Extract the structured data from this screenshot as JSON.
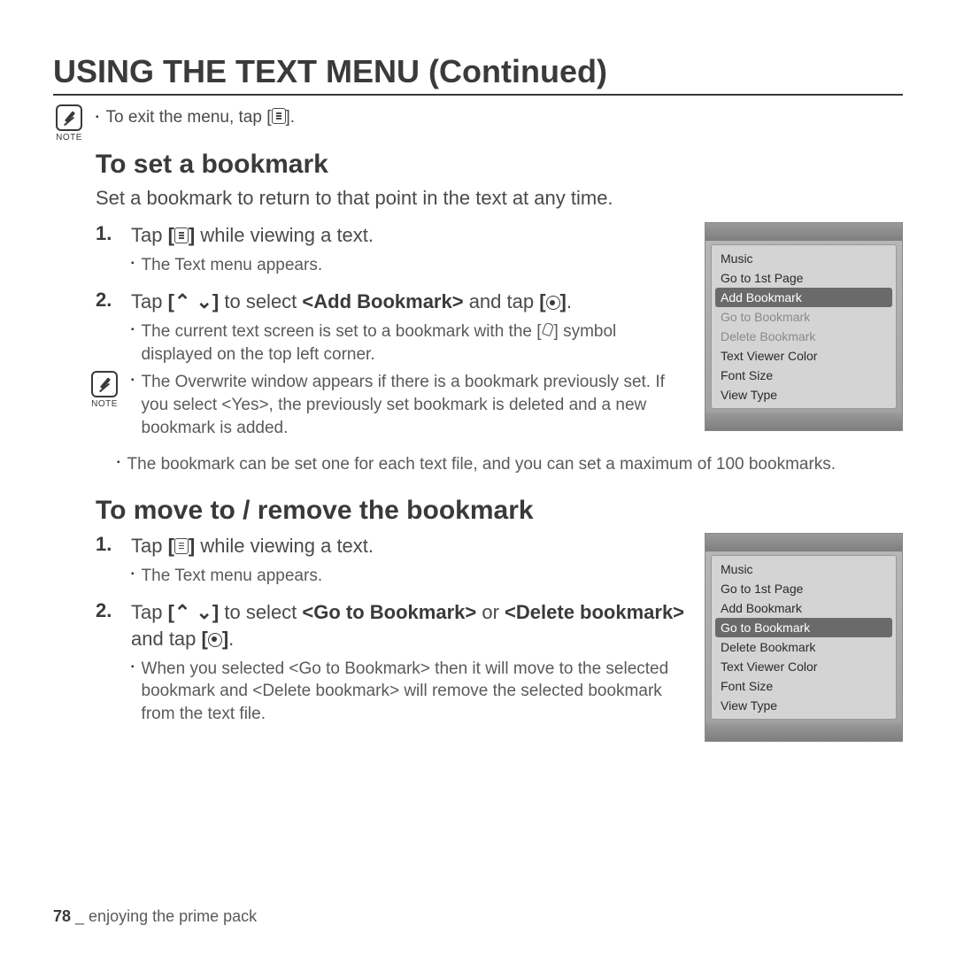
{
  "page_title": "USING THE TEXT MENU (Continued)",
  "top_note": {
    "label": "NOTE",
    "text_before": "To exit the menu, tap [",
    "text_after": "]."
  },
  "section1": {
    "heading": "To set a bookmark",
    "intro": "Set a bookmark to return to that point in the text at any time.",
    "step1": {
      "num": "1.",
      "text_before": "Tap ",
      "bold_open": "[",
      "bold_close": "]",
      "text_after": " while viewing a text.",
      "sub1": "The Text menu appears."
    },
    "step2": {
      "num": "2.",
      "line1_a": "Tap ",
      "line1_bold": "[",
      "line1_mid": " to select ",
      "line1_bold2": "<Add Bookmark>",
      "line1_end": " and tap ",
      "line1_close": ".",
      "sub1_a": "The current text screen is set to a bookmark with the [",
      "sub1_b": "] symbol displayed on the top left corner."
    },
    "note_block": {
      "label": "NOTE",
      "b1": "The Overwrite window appears if there is a bookmark previously set. If you select <Yes>, the previously set bookmark is deleted and a new bookmark is added.",
      "b2": "The bookmark can be set one for each text file, and you can set a maximum of 100 bookmarks."
    },
    "device_menu": {
      "items": [
        {
          "label": "Music",
          "selected": false,
          "dim": false
        },
        {
          "label": "Go to 1st Page",
          "selected": false,
          "dim": false
        },
        {
          "label": "Add Bookmark",
          "selected": true,
          "dim": false
        },
        {
          "label": "Go to Bookmark",
          "selected": false,
          "dim": true
        },
        {
          "label": "Delete Bookmark",
          "selected": false,
          "dim": true
        },
        {
          "label": "Text Viewer Color",
          "selected": false,
          "dim": false
        },
        {
          "label": "Font Size",
          "selected": false,
          "dim": false
        },
        {
          "label": "View Type",
          "selected": false,
          "dim": false
        }
      ]
    }
  },
  "section2": {
    "heading": "To move to / remove the bookmark",
    "step1": {
      "num": "1.",
      "text_before": "Tap ",
      "bold_open": "[",
      "bold_close": "]",
      "text_after": " while viewing a text.",
      "sub1": "The Text menu appears."
    },
    "step2": {
      "num": "2.",
      "line_a": "Tap ",
      "bold_open": "[",
      "line_b": " to select ",
      "bold1": "<Go to Bookmark>",
      "line_c": " or ",
      "bold2": "<Delete bookmark>",
      "line_d": " and tap ",
      "bold_close": "]",
      "line_end": ".",
      "sub1": "When you selected <Go to Bookmark> then it will move to the selected bookmark and <Delete bookmark> will remove the selected bookmark from the text file."
    },
    "device_menu": {
      "items": [
        {
          "label": "Music",
          "selected": false,
          "dim": false
        },
        {
          "label": "Go to 1st Page",
          "selected": false,
          "dim": false
        },
        {
          "label": "Add Bookmark",
          "selected": false,
          "dim": false
        },
        {
          "label": "Go to Bookmark",
          "selected": true,
          "dim": false
        },
        {
          "label": "Delete Bookmark",
          "selected": false,
          "dim": false
        },
        {
          "label": "Text Viewer Color",
          "selected": false,
          "dim": false
        },
        {
          "label": "Font Size",
          "selected": false,
          "dim": false
        },
        {
          "label": "View Type",
          "selected": false,
          "dim": false
        }
      ]
    }
  },
  "footer": {
    "page_num": "78",
    "sep": " _ ",
    "text": "enjoying the prime pack"
  }
}
